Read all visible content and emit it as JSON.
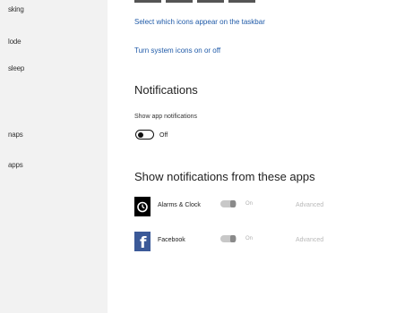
{
  "sidebar": {
    "items": [
      {
        "label": "sking"
      },
      {
        "label": "lode"
      },
      {
        "label": "sleep"
      },
      {
        "label": "naps"
      },
      {
        "label": "apps"
      }
    ]
  },
  "taskbar_section": {
    "select_icons_link": "Select which icons appear on the taskbar",
    "system_icons_link": "Turn system icons on or off"
  },
  "notifications": {
    "heading": "Notifications",
    "show_app_notifications_label": "Show app notifications",
    "toggle_state": "Off"
  },
  "apps_section": {
    "heading": "Show notifications from these apps",
    "apps": [
      {
        "name": "Alarms & Clock",
        "state": "On",
        "advanced": "Advanced",
        "icon": "alarm-clock-icon"
      },
      {
        "name": "Facebook",
        "state": "On",
        "advanced": "Advanced",
        "icon": "facebook-icon"
      }
    ]
  },
  "colors": {
    "link": "#1f5aa8",
    "facebook_blue": "#3b5998",
    "sidebar_bg": "#f2f2f2"
  }
}
